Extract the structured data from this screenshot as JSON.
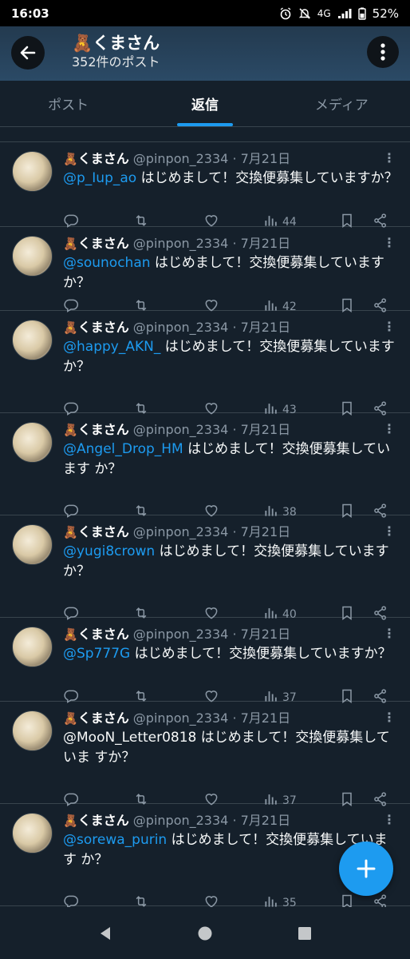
{
  "status_bar": {
    "time": "16:03",
    "network": "4G",
    "battery": "52%"
  },
  "header": {
    "name": "くまさん",
    "bear": "🧸",
    "post_count": "352件のポスト"
  },
  "tabs": [
    {
      "label": "ポスト",
      "active": false
    },
    {
      "label": "返信",
      "active": true
    },
    {
      "label": "メディア",
      "active": false
    }
  ],
  "posts": [
    {
      "name": "くまさん",
      "handle": "@pinpon_2334",
      "date": "· 7月21日",
      "mention": "@p_Iup_ao",
      "text": " はじめまして！交換便募集していますか？",
      "views": "44"
    },
    {
      "name": "くまさん",
      "handle": "@pinpon_2334",
      "date": "· 7月21日",
      "mention": "@sounochan",
      "text": " はじめまして！交換便募集していますか？",
      "views": "42"
    },
    {
      "name": "くまさん",
      "handle": "@pinpon_2334",
      "date": "· 7月21日",
      "mention": "@happy_AKN_",
      "text": " はじめまして！交換便募集しています か？",
      "views": "43"
    },
    {
      "name": "くまさん",
      "handle": "@pinpon_2334",
      "date": "· 7月21日",
      "mention": "@Angel_Drop_HM",
      "text": " はじめまして！交換便募集しています か？",
      "views": "38"
    },
    {
      "name": "くまさん",
      "handle": "@pinpon_2334",
      "date": "· 7月21日",
      "mention": "@yugi8crown",
      "text": " はじめまして！交換便募集しています か？",
      "views": "40"
    },
    {
      "name": "くまさん",
      "handle": "@pinpon_2334",
      "date": "· 7月21日",
      "mention": "@Sp777G",
      "text": " はじめまして！交換便募集していますか？",
      "views": "37"
    },
    {
      "name": "くまさん",
      "handle": "@pinpon_2334",
      "date": "· 7月21日",
      "mention": "",
      "text": "@MooN_Letter0818 はじめまして！交換便募集していま すか？",
      "views": "37"
    },
    {
      "name": "くまさん",
      "handle": "@pinpon_2334",
      "date": "· 7月21日",
      "mention": "@sorewa_purin",
      "text": " はじめまして！交換便募集していま す か？",
      "views": "35"
    }
  ],
  "icons": {
    "back": "back-arrow-icon",
    "more": "more-vertical-icon",
    "reply": "reply-icon",
    "retweet": "retweet-icon",
    "like": "heart-icon",
    "views": "views-icon",
    "bookmark": "bookmark-icon",
    "share": "share-icon",
    "compose": "plus-icon"
  },
  "colors": {
    "background": "#15202b",
    "accent": "#1d9bf0",
    "muted": "#8b98a5",
    "divider": "#38444d"
  }
}
